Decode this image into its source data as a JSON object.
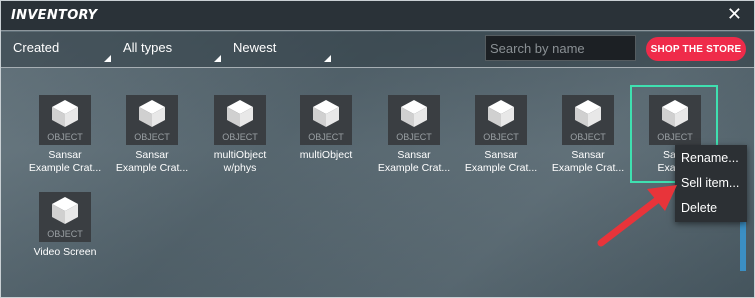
{
  "window": {
    "title": "INVENTORY"
  },
  "toolbar": {
    "filter_created": "Created",
    "filter_types": "All types",
    "filter_sort": "Newest",
    "search_placeholder": "Search by name",
    "shop_label": "SHOP THE STORE"
  },
  "items": [
    {
      "thumb_label": "OBJECT",
      "name_line1": "Sansar",
      "name_line2": "Example Crat..."
    },
    {
      "thumb_label": "OBJECT",
      "name_line1": "Sansar",
      "name_line2": "Example Crat..."
    },
    {
      "thumb_label": "OBJECT",
      "name_line1": "multiObject",
      "name_line2": "w/phys"
    },
    {
      "thumb_label": "OBJECT",
      "name_line1": "multiObject",
      "name_line2": ""
    },
    {
      "thumb_label": "OBJECT",
      "name_line1": "Sansar",
      "name_line2": "Example Crat..."
    },
    {
      "thumb_label": "OBJECT",
      "name_line1": "Sansar",
      "name_line2": "Example Crat..."
    },
    {
      "thumb_label": "OBJECT",
      "name_line1": "Sansar",
      "name_line2": "Example Crat..."
    },
    {
      "thumb_label": "OBJECT",
      "name_line1": "Sans",
      "name_line2": "Exampl"
    },
    {
      "thumb_label": "OBJECT",
      "name_line1": "Video Screen",
      "name_line2": ""
    }
  ],
  "context_menu": {
    "rename": "Rename...",
    "sell": "Sell item...",
    "delete": "Delete"
  },
  "colors": {
    "accent": "#ef2b4a",
    "selection": "#3fe0b0",
    "annotation_arrow": "#e8343a"
  },
  "icons": {
    "close": "close-icon",
    "object_thumbnail": "cube-icon",
    "dropdown": "dropdown-corner-icon",
    "annotation": "arrow-pointer-icon"
  }
}
